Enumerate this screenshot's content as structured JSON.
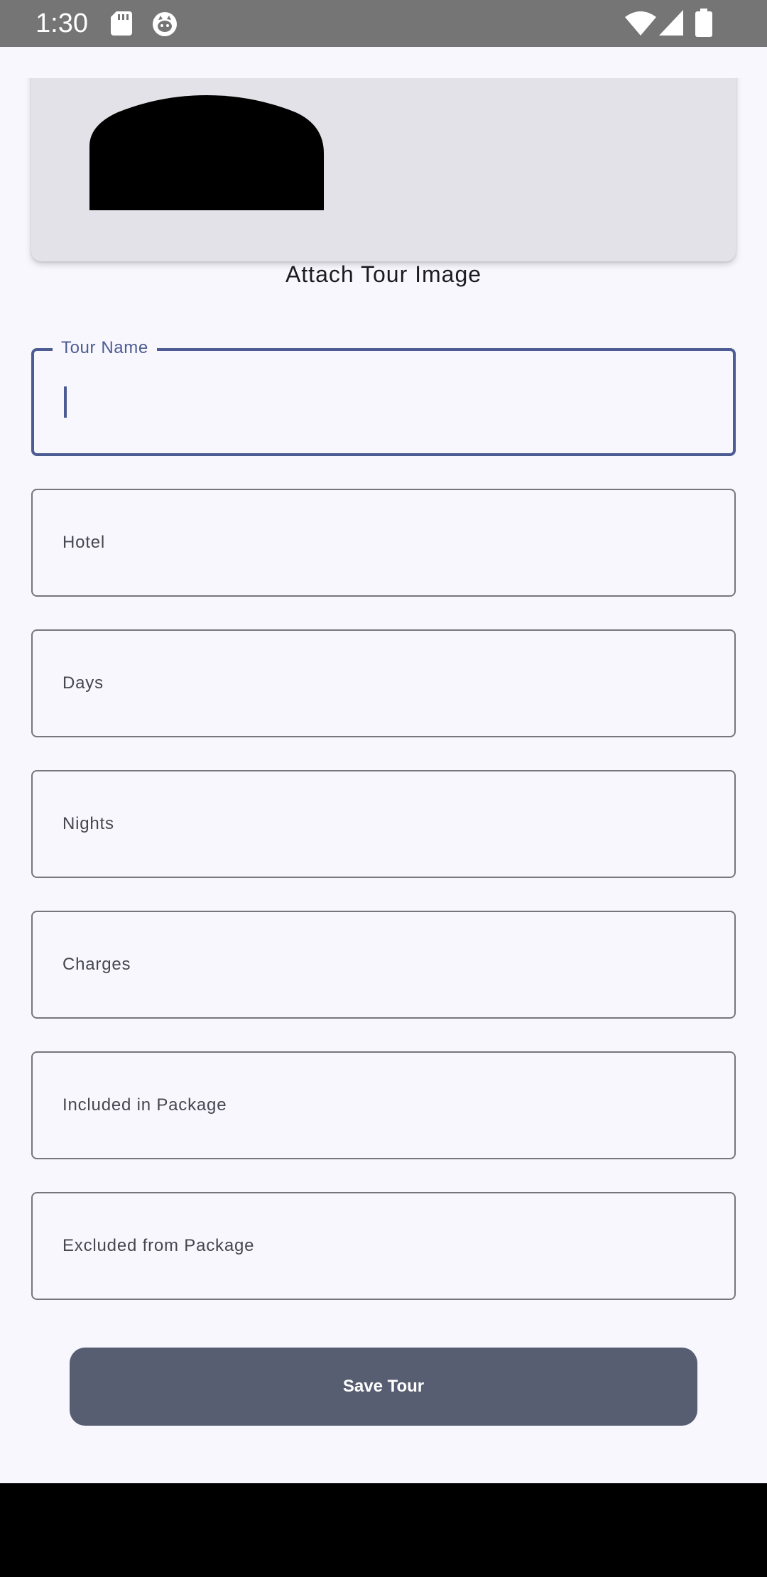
{
  "status_bar": {
    "time": "1:30",
    "icons": [
      "sd-card-icon",
      "cat-face-icon",
      "wifi-icon",
      "signal-icon",
      "battery-icon"
    ]
  },
  "image_attach": {
    "label": "Attach Tour Image",
    "placeholder_icon": "person-placeholder-icon"
  },
  "form": {
    "tour_name": {
      "label": "Tour Name",
      "value": ""
    },
    "hotel": {
      "label": "Hotel"
    },
    "days": {
      "label": "Days"
    },
    "nights": {
      "label": "Nights"
    },
    "charges": {
      "label": "Charges"
    },
    "included": {
      "label": "Included in Package"
    },
    "excluded": {
      "label": "Excluded from Package"
    }
  },
  "save_button": {
    "label": "Save Tour"
  },
  "colors": {
    "status_bar": "#757575",
    "background": "#f8f7fe",
    "image_card": "#e3e2e8",
    "focus_outline": "#4d5c92",
    "outline": "#76767e",
    "button": "#585e72"
  }
}
